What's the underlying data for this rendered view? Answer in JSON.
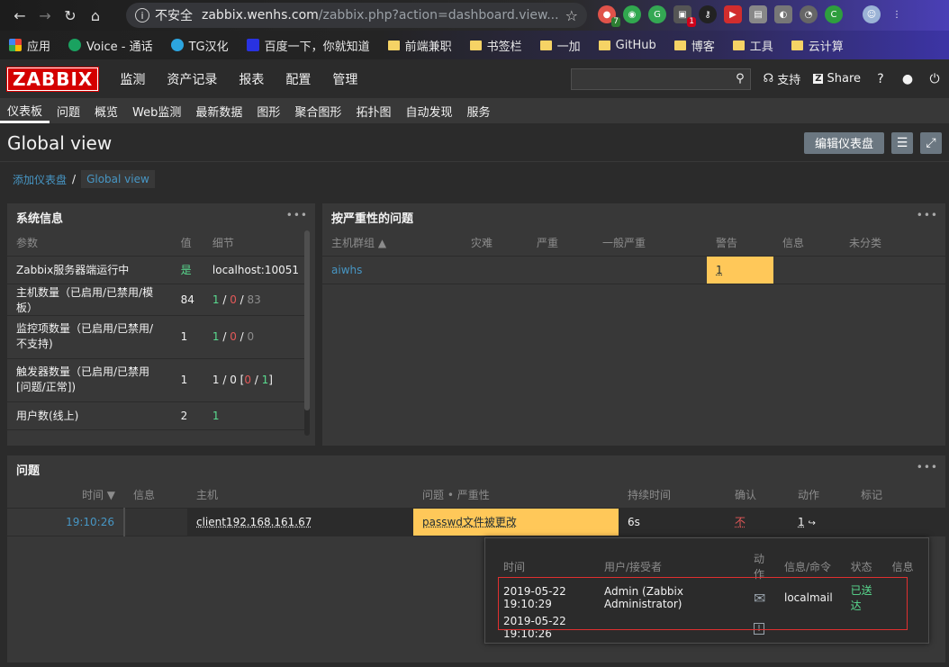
{
  "browser": {
    "insecure_label": "不安全",
    "url_host": "zabbix.wenhs.com",
    "url_path": "/zabbix.php?action=dashboard.view...",
    "extensions": [
      {
        "name": "ext-color",
        "color": "#e0534a",
        "badge": "7"
      },
      {
        "name": "ext-chat",
        "color": "#31a84f"
      },
      {
        "name": "ext-g",
        "color": "#34a853"
      },
      {
        "name": "ext-box",
        "color": "#555555",
        "badge": "1"
      },
      {
        "name": "ext-key",
        "color": "#222222"
      },
      {
        "name": "ext-video",
        "color": "#d22d2d"
      },
      {
        "name": "ext-card",
        "color": "#888888"
      },
      {
        "name": "ext-bulb",
        "color": "#777777"
      },
      {
        "name": "ext-gauge",
        "color": "#666666"
      },
      {
        "name": "ext-c",
        "color": "#2e9e3e"
      }
    ]
  },
  "bookmarks": [
    {
      "label": "应用",
      "icon": "apps-icon"
    },
    {
      "label": "Voice - 通话",
      "icon": "voice-icon"
    },
    {
      "label": "TG汉化",
      "icon": "telegram-icon"
    },
    {
      "label": "百度一下，你就知道",
      "icon": "baidu-icon"
    },
    {
      "label": "前端兼职",
      "icon": "folder-icon"
    },
    {
      "label": "书签栏",
      "icon": "folder-icon"
    },
    {
      "label": "一加",
      "icon": "folder-icon"
    },
    {
      "label": "GitHub",
      "icon": "folder-icon"
    },
    {
      "label": "博客",
      "icon": "folder-icon"
    },
    {
      "label": "工具",
      "icon": "folder-icon"
    },
    {
      "label": "云计算",
      "icon": "folder-icon"
    }
  ],
  "header": {
    "logo": "ZABBIX",
    "menu": [
      "监测",
      "资产记录",
      "报表",
      "配置",
      "管理"
    ],
    "support": "支持",
    "share": "Share",
    "help": "?"
  },
  "submenu": [
    "仪表板",
    "问题",
    "概览",
    "Web监测",
    "最新数据",
    "图形",
    "聚合图形",
    "拓扑图",
    "自动发现",
    "服务"
  ],
  "page": {
    "title": "Global view",
    "edit_button": "编辑仪表盘",
    "breadcrumb_root": "添加仪表盘",
    "breadcrumb_current": "Global view"
  },
  "system_info": {
    "title": "系统信息",
    "columns": [
      "参数",
      "值",
      "细节"
    ],
    "rows": [
      {
        "param": "Zabbix服务器端运行中",
        "value": "是",
        "detail": "localhost:10051"
      },
      {
        "param": "主机数量（已启用/已禁用/模板）",
        "value": "84",
        "d1": "1",
        "d2": "0",
        "d3": "83"
      },
      {
        "param": "监控项数量（已启用/已禁用/不支持)",
        "value": "1",
        "d1": "1",
        "d2": "0",
        "d3": "0"
      },
      {
        "param": "触发器数量（已启用/已禁用 [问题/正常])",
        "value": "1",
        "t1": "1 / 0 [",
        "t2": "0",
        "t3": " / ",
        "t4": "1",
        "t5": "]"
      },
      {
        "param": "用户数(线上)",
        "value": "2",
        "detail": "1"
      }
    ]
  },
  "severity": {
    "title": "按严重性的问题",
    "columns": [
      "主机群组 ▲",
      "灾难",
      "严重",
      "一般严重",
      "警告",
      "信息",
      "未分类"
    ],
    "row": {
      "group": "aiwhs",
      "warning": "1"
    }
  },
  "problems": {
    "title": "问题",
    "columns": [
      "时间 ▼",
      "信息",
      "主机",
      "问题 • 严重性",
      "持续时间",
      "确认",
      "动作",
      "标记"
    ],
    "row": {
      "time": "19:10:26",
      "host": "client192.168.161.67",
      "problem": "passwd文件被更改",
      "duration": "6s",
      "ack": "不",
      "actions": "1"
    }
  },
  "popup": {
    "columns": [
      "时间",
      "用户/接受者",
      "动作",
      "信息/命令",
      "状态",
      "信息"
    ],
    "rows": [
      {
        "time": "2019-05-22 19:10:29",
        "user": "Admin (Zabbix Administrator)",
        "icon": "envelope-icon",
        "command": "localmail",
        "status": "已送达"
      },
      {
        "time": "2019-05-22 19:10:26",
        "user": "",
        "icon": "calendar-alert-icon",
        "command": "",
        "status": ""
      }
    ]
  }
}
